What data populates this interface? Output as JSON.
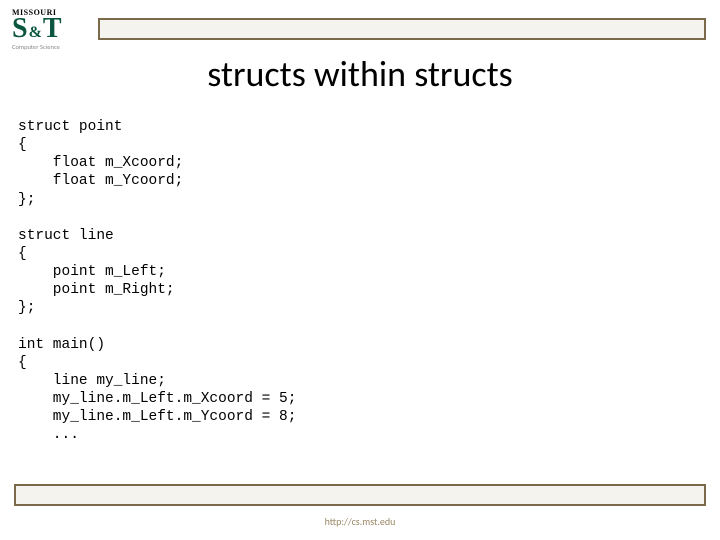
{
  "logo": {
    "top": "MISSOURI",
    "s": "S",
    "amp": "&",
    "t": "T",
    "sub": "Computer Science"
  },
  "title": "structs within structs",
  "code": "struct point\n{\n    float m_Xcoord;\n    float m_Ycoord;\n};\n\nstruct line\n{\n    point m_Left;\n    point m_Right;\n};\n\nint main()\n{\n    line my_line;\n    my_line.m_Left.m_Xcoord = 5;\n    my_line.m_Left.m_Ycoord = 8;\n    ...",
  "footer": "http://cs.mst.edu"
}
